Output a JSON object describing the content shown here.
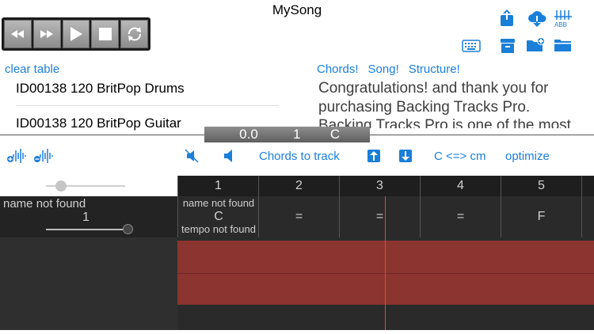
{
  "app": {
    "title": "MySong"
  },
  "transport": {
    "buttons": [
      {
        "name": "rewind-icon"
      },
      {
        "name": "fast-forward-icon"
      },
      {
        "name": "play-icon"
      },
      {
        "name": "stop-icon"
      },
      {
        "name": "loop-icon"
      }
    ]
  },
  "top_icons": [
    "share-icon",
    "cloud-download-icon",
    "guitar-tab-icon",
    "keyboard-icon",
    "archive-icon",
    "folder-add-icon",
    "folder-icon"
  ],
  "tracklist": {
    "clear_label": "clear table",
    "items": [
      {
        "label": "ID00138 120 BritPop Drums"
      },
      {
        "label": "ID00138 120 BritPop Guitar"
      }
    ]
  },
  "info_tabs": [
    "Chords!",
    "Song!",
    "Structure!"
  ],
  "info_text": "Congratulations! and thank you for purchasing Backing Tracks Pro. Backing Tracks Pro is one of the most",
  "position": {
    "time": "0.0",
    "bar": "1",
    "chord": "C"
  },
  "toolbar": {
    "chords_to_track": "Chords to track",
    "transpose": "C <=> cm",
    "optimize": "optimize"
  },
  "ruler": [
    "1",
    "2",
    "3",
    "4",
    "5"
  ],
  "track_header": {
    "name": "name not found",
    "number": "1"
  },
  "chord_cells": [
    {
      "chord": "C",
      "top": "name not found",
      "bottom": "tempo not found"
    },
    {
      "chord": "="
    },
    {
      "chord": "="
    },
    {
      "chord": "="
    },
    {
      "chord": "F"
    }
  ],
  "colors": {
    "accent": "#1a7fd8",
    "clip": "#8b3430",
    "playhead": "#ff3b30"
  }
}
